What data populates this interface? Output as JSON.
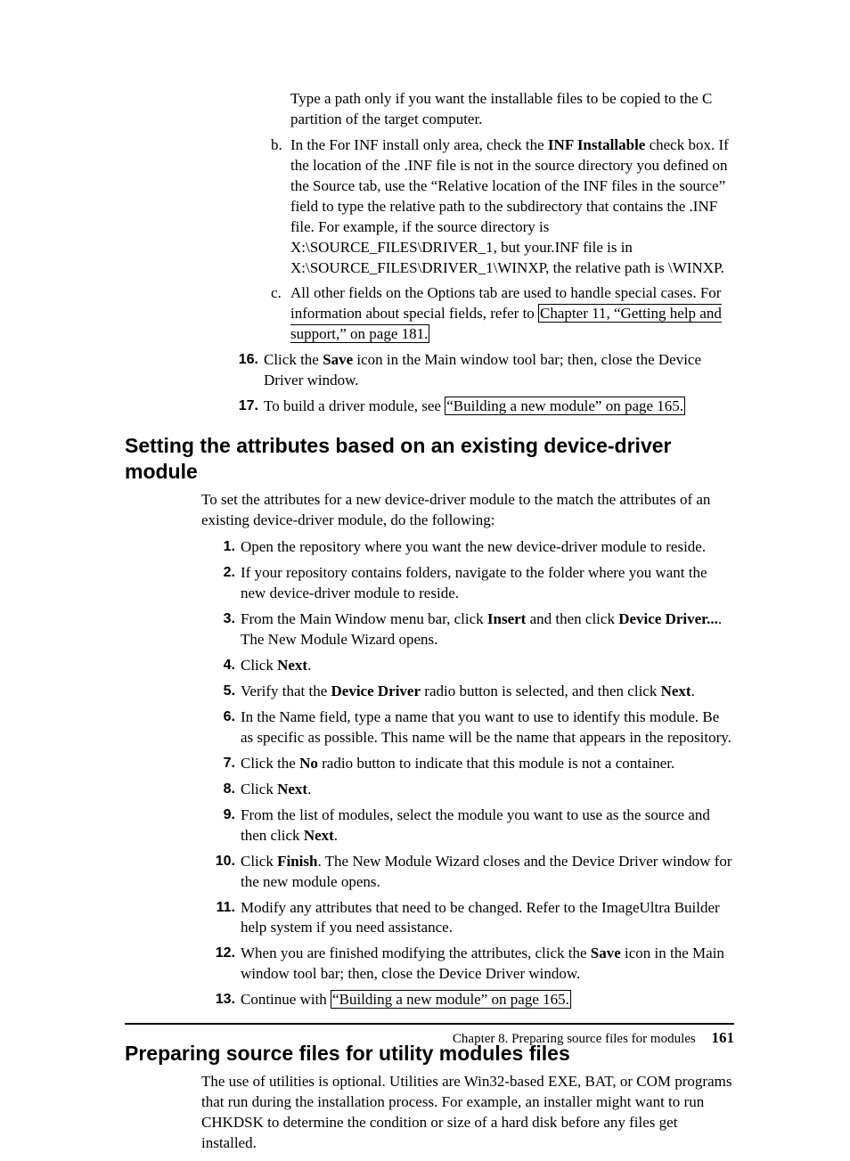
{
  "top": {
    "line1": "Type a path only if you want the installable files to be copied to the C partition of the target computer.",
    "b": {
      "pre": "In the For INF install only area, check the ",
      "bold1": "INF Installable",
      "post": " check box. If the location of the .INF file is not in the source directory you defined on the Source tab, use the “Relative location of the INF files in the source” field to type the relative path to the subdirectory that contains the .INF file. For example, if the source directory is X:\\SOURCE_FILES\\DRIVER_1, but your.INF file is in X:\\SOURCE_FILES\\DRIVER_1\\WINXP, the relative path is \\WINXP."
    },
    "c": {
      "pre": "All other fields on the Options tab are used to handle special cases. For information about special fields, refer to ",
      "link": "Chapter 11, “Getting help and support,” on page 181."
    },
    "s16": {
      "pre": "Click the ",
      "bold": "Save",
      "post": " icon in the Main window tool bar; then, close the Device Driver window."
    },
    "s17": {
      "pre": "To build a driver module, see ",
      "link": "“Building a new module” on page 165."
    }
  },
  "heading1": "Setting the attributes based on an existing device-driver module",
  "intro1": "To set the attributes for a new device-driver module to the match the attributes of an existing device-driver module, do the following:",
  "steps": {
    "s1": "Open the repository where you want the new device-driver module to reside.",
    "s2": "If your repository contains folders, navigate to the folder where you want the new device-driver module to reside.",
    "s3": {
      "pre": "From the Main Window menu bar, click ",
      "b1": "Insert",
      "mid": " and then click ",
      "b2": "Device Driver...",
      "post": ". The New Module Wizard opens."
    },
    "s4": {
      "pre": "Click ",
      "b1": "Next",
      "post": "."
    },
    "s5": {
      "pre": "Verify that the ",
      "b1": "Device Driver",
      "mid": " radio button is selected, and then click ",
      "b2": "Next",
      "post": "."
    },
    "s6": "In the Name field, type a name that you want to use to identify this module. Be as specific as possible. This name will be the name that appears in the repository.",
    "s7": {
      "pre": "Click the ",
      "b1": "No",
      "post": " radio button to indicate that this module is not a container."
    },
    "s8": {
      "pre": " Click ",
      "b1": "Next",
      "post": "."
    },
    "s9": {
      "pre": "From the list of modules, select the module you want to use as the source and then click ",
      "b1": "Next",
      "post": "."
    },
    "s10": {
      "pre": "Click ",
      "b1": "Finish",
      "post": ". The New Module Wizard closes and the Device Driver window for the new module opens."
    },
    "s11": "Modify any attributes that need to be changed. Refer to the ImageUltra Builder help system if you need assistance.",
    "s12": {
      "pre": "When you are finished modifying the attributes, click the ",
      "b1": "Save",
      "post": " icon in the Main window tool bar; then, close the Device Driver window."
    },
    "s13": {
      "pre": "Continue with ",
      "link": "“Building a new module” on page 165."
    }
  },
  "heading2": "Preparing source files for utility modules files",
  "intro2": "The use of utilities is optional. Utilities are Win32-based EXE, BAT, or COM programs that run during the installation process. For example, an installer might want to run CHKDSK to determine the condition or size of a hard disk before any files get installed.",
  "footer": {
    "chapter": "Chapter 8. Preparing source files for modules",
    "page": "161"
  },
  "labels": {
    "b": "b.",
    "c": "c.",
    "n16": "16.",
    "n17": "17.",
    "n1": "1.",
    "n2": "2.",
    "n3": "3.",
    "n4": "4.",
    "n5": "5.",
    "n6": "6.",
    "n7": "7.",
    "n8": "8.",
    "n9": "9.",
    "n10": "10.",
    "n11": "11.",
    "n12": "12.",
    "n13": "13."
  }
}
